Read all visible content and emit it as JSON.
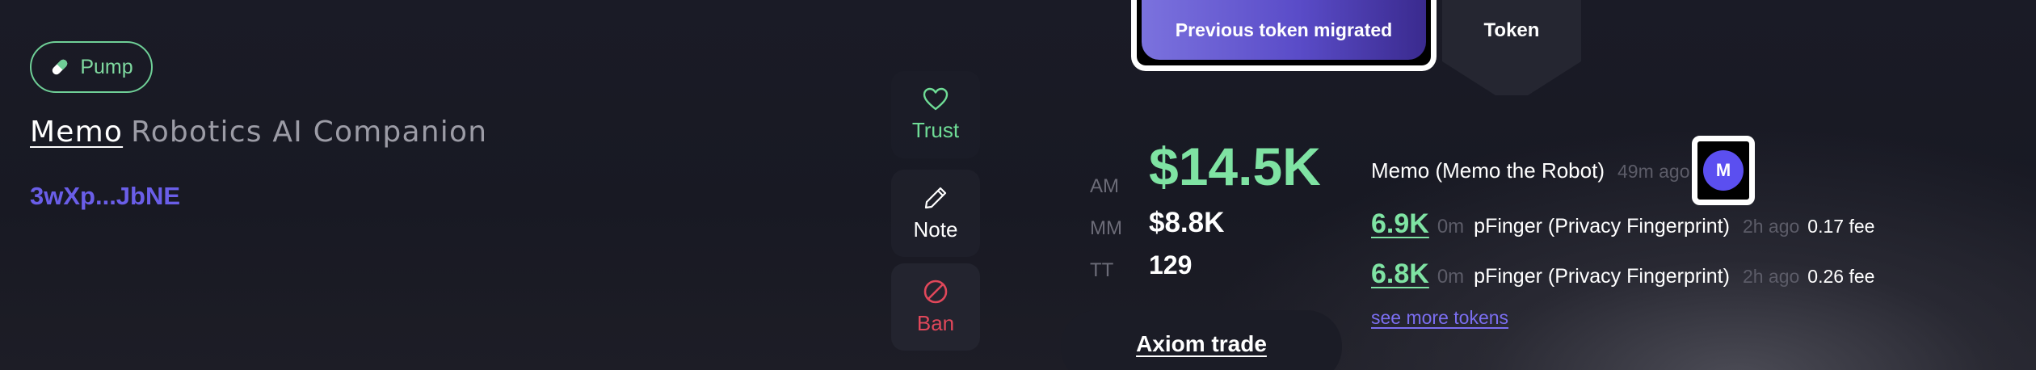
{
  "badge": {
    "label": "Pump",
    "icon": "pill-icon",
    "color": "#6fcf97"
  },
  "token": {
    "ticker": "Memo",
    "name": "Robotics AI Companion",
    "address": "3wXp...JbNE"
  },
  "actions": {
    "trust": {
      "label": "Trust",
      "icon": "heart-icon",
      "color": "#6fdc96"
    },
    "note": {
      "label": "Note",
      "icon": "pencil-icon",
      "color": "#ffffff"
    },
    "ban": {
      "label": "Ban",
      "icon": "ban-icon",
      "color": "#e0475a"
    }
  },
  "tabs": {
    "previous": "Previous token migrated",
    "token": "Token"
  },
  "stats": {
    "am_label": "AM",
    "am_value": "$14.5K",
    "mm_label": "MM",
    "mm_value": "$8.8K",
    "tt_label": "TT",
    "tt_value": "129"
  },
  "axiom_label": "Axiom trade",
  "related": {
    "main": {
      "name": "Memo (Memo the Robot)",
      "ago": "49m ago",
      "avatar": "M"
    },
    "rows": [
      {
        "cap": "6.9K",
        "age": "0m",
        "name": "pFinger (Privacy Fingerprint)",
        "ago": "2h ago",
        "fee": "0.17 fee"
      },
      {
        "cap": "6.8K",
        "age": "0m",
        "name": "pFinger (Privacy Fingerprint)",
        "ago": "2h ago",
        "fee": "0.26 fee"
      }
    ],
    "see_more": "see more tokens"
  },
  "colors": {
    "accent_green": "#7fe3a3",
    "accent_purple": "#6a5ee8",
    "danger": "#e0475a",
    "background": "#181923"
  }
}
